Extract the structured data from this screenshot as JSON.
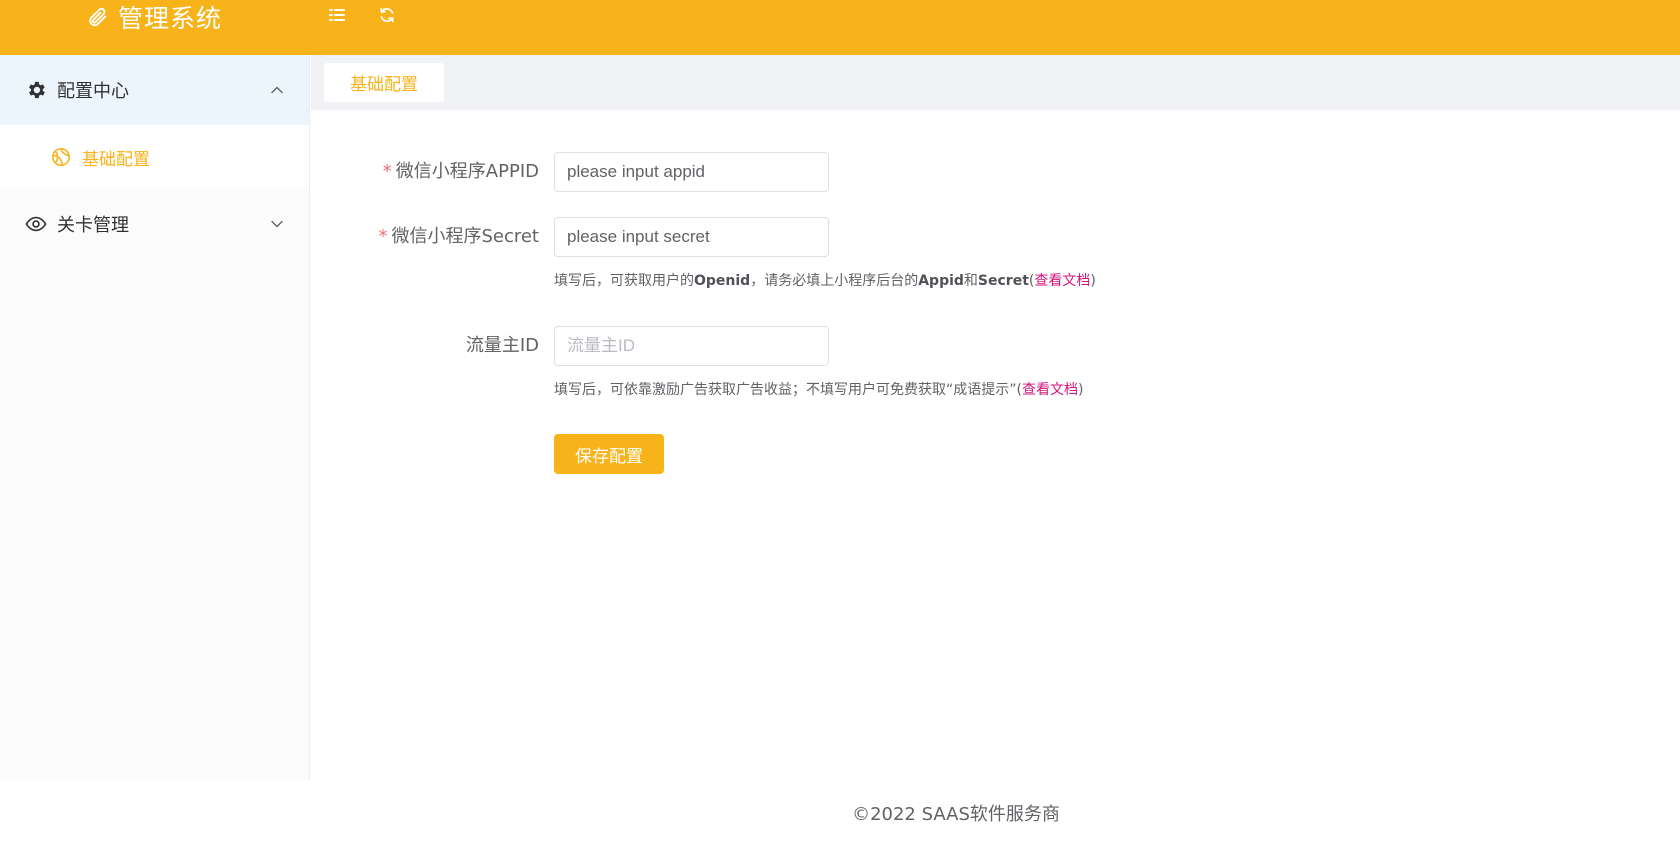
{
  "header": {
    "app_title": "管理系统",
    "logo_icon": "paperclip-icon",
    "toggle_icon": "menu-toggle-icon",
    "refresh_icon": "refresh-icon",
    "background_color": "#f7b319"
  },
  "sidebar": {
    "groups": [
      {
        "label": "配置中心",
        "icon": "gear-icon",
        "expanded": true,
        "items": [
          {
            "label": "基础配置",
            "icon": "basketball-icon",
            "active": true
          }
        ]
      },
      {
        "label": "关卡管理",
        "icon": "eye-icon",
        "expanded": false,
        "items": []
      }
    ]
  },
  "tabs": [
    {
      "label": "基础配置",
      "active": true
    }
  ],
  "form": {
    "appid": {
      "label": "微信小程序APPID",
      "required": true,
      "value": "please input appid",
      "placeholder": ""
    },
    "secret": {
      "label": "微信小程序Secret",
      "required": true,
      "value": "please input secret",
      "placeholder": ""
    },
    "secret_hint": {
      "t1": "填写后，可获取用户的",
      "b1": "Openid",
      "t2": "，请务必填上小程序后台的",
      "b2": "Appid",
      "t3": "和",
      "b3": "Secret",
      "open": "(",
      "link": "查看文档",
      "close": ")"
    },
    "traffic": {
      "label": "流量主ID",
      "required": false,
      "value": "",
      "placeholder": "流量主ID"
    },
    "traffic_hint": {
      "t1": "填写后，可依靠激励广告获取广告收益；不填写用户可免费获取“成语提示”",
      "open": "(",
      "link": "查看文档",
      "close": ")"
    },
    "save_label": "保存配置"
  },
  "footer": {
    "copyright": "©2022 SAAS软件服务商"
  },
  "colors": {
    "accent": "#f7b319",
    "required": "#f56c6c",
    "link": "#d4157a",
    "sidebar_active": "#ecf4fd"
  }
}
